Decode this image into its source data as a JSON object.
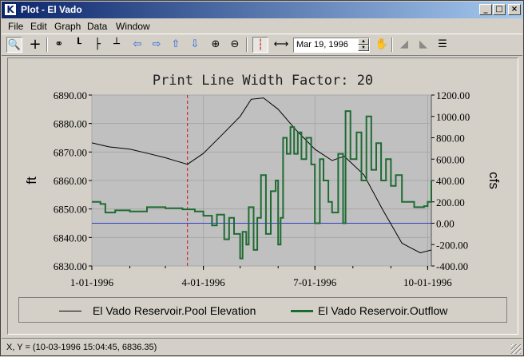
{
  "window": {
    "title": "Plot - El Vado",
    "min_label": "_",
    "max_label": "□",
    "close_label": "×"
  },
  "menu": [
    "File",
    "Edit",
    "Graph",
    "Data",
    "Window"
  ],
  "toolbar": {
    "date_value": "Mar 19, 1996"
  },
  "chart_data": {
    "type": "line",
    "title": "Print Line Width Factor: 20",
    "ylabel": "ft",
    "y2label": "cfs",
    "x_ticks": [
      "1-01-1996",
      "4-01-1996",
      "7-01-1996",
      "10-01-1996"
    ],
    "y_ticks": [
      "6890.00",
      "6880.00",
      "6870.00",
      "6860.00",
      "6850.00",
      "6840.00",
      "6830.00"
    ],
    "y2_ticks": [
      "1200.00",
      "1000.00",
      "800.00",
      "600.00",
      "400.00",
      "200.00",
      "0.00",
      "-200.00",
      "-400.00"
    ],
    "ylim": [
      6830,
      6890
    ],
    "y2lim": [
      -400,
      1200
    ],
    "xlim": [
      "1996-01-01",
      "1996-10-04"
    ],
    "cursor_date": "1996-03-19",
    "series": [
      {
        "name": "El Vado Reservoir.Pool Elevation",
        "axis": "left",
        "color": "#000000",
        "x": [
          "1996-01-01",
          "1996-01-15",
          "1996-02-01",
          "1996-02-15",
          "1996-03-01",
          "1996-03-10",
          "1996-03-19",
          "1996-04-01",
          "1996-04-15",
          "1996-05-01",
          "1996-05-10",
          "1996-05-20",
          "1996-06-01",
          "1996-06-15",
          "1996-07-01",
          "1996-07-15",
          "1996-07-25",
          "1996-08-10",
          "1996-08-25",
          "1996-09-10",
          "1996-09-25",
          "1996-10-04"
        ],
        "values": [
          6873.2,
          6871.8,
          6871.0,
          6869.6,
          6868.0,
          6866.8,
          6865.7,
          6869.5,
          6875.5,
          6882.5,
          6888.5,
          6889.0,
          6885.0,
          6878.0,
          6871.0,
          6867.0,
          6868.5,
          6862.0,
          6850.0,
          6838.0,
          6834.6,
          6835.6
        ]
      },
      {
        "name": "El Vado Reservoir.Outflow",
        "axis": "right",
        "color": "#1e6b32",
        "x": [
          "1996-01-01",
          "1996-01-08",
          "1996-01-12",
          "1996-01-20",
          "1996-02-01",
          "1996-02-15",
          "1996-03-01",
          "1996-03-15",
          "1996-03-25",
          "1996-04-01",
          "1996-04-08",
          "1996-04-12",
          "1996-04-18",
          "1996-04-22",
          "1996-04-26",
          "1996-05-01",
          "1996-05-03",
          "1996-05-06",
          "1996-05-08",
          "1996-05-12",
          "1996-05-15",
          "1996-05-18",
          "1996-05-22",
          "1996-05-26",
          "1996-05-30",
          "1996-06-01",
          "1996-06-03",
          "1996-06-05",
          "1996-06-08",
          "1996-06-11",
          "1996-06-14",
          "1996-06-17",
          "1996-06-20",
          "1996-06-24",
          "1996-06-28",
          "1996-07-01",
          "1996-07-05",
          "1996-07-08",
          "1996-07-12",
          "1996-07-15",
          "1996-07-20",
          "1996-07-24",
          "1996-07-26",
          "1996-07-30",
          "1996-08-04",
          "1996-08-08",
          "1996-08-12",
          "1996-08-16",
          "1996-08-20",
          "1996-08-24",
          "1996-08-28",
          "1996-09-01",
          "1996-09-05",
          "1996-09-10",
          "1996-09-20",
          "1996-09-28",
          "1996-10-01",
          "1996-10-04"
        ],
        "values": [
          200,
          180,
          100,
          120,
          110,
          150,
          140,
          130,
          110,
          70,
          -20,
          80,
          -150,
          50,
          -100,
          -330,
          -80,
          -200,
          150,
          -250,
          50,
          450,
          -100,
          300,
          400,
          -200,
          50,
          800,
          650,
          900,
          650,
          850,
          600,
          800,
          550,
          0,
          600,
          400,
          200,
          100,
          650,
          0,
          1050,
          600,
          850,
          400,
          1000,
          500,
          750,
          400,
          600,
          350,
          450,
          200,
          150,
          160,
          200,
          400
        ]
      }
    ],
    "legend": "bottom",
    "grid": true,
    "zero_line_color": "#2d3fc8"
  },
  "status": {
    "text": "X, Y = (10-03-1996 15:04:45, 6836.35)"
  }
}
